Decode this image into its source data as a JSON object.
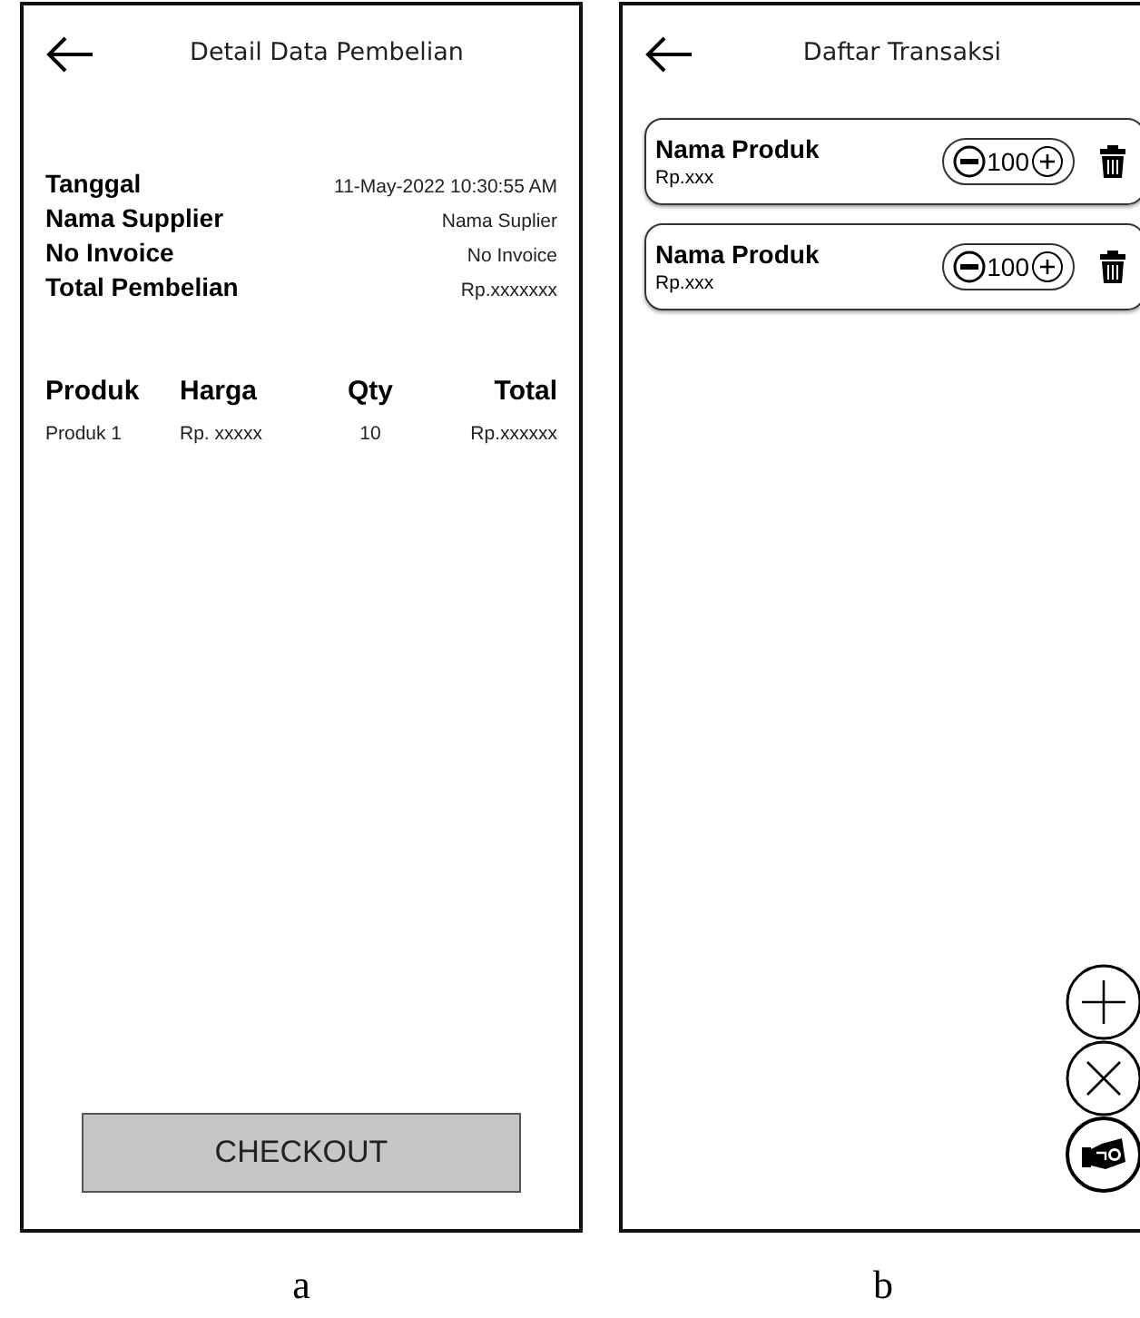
{
  "detail_screen": {
    "title": "Detail Data Pembelian",
    "fields": [
      {
        "label": "Tanggal",
        "value": "11-May-2022 10:30:55 AM"
      },
      {
        "label": "Nama Supplier",
        "value": "Nama Suplier"
      },
      {
        "label": "No Invoice",
        "value": "No Invoice"
      },
      {
        "label": "Total Pembelian",
        "value": "Rp.xxxxxxx"
      }
    ],
    "table": {
      "columns": [
        "Produk",
        "Harga",
        "Qty",
        "Total"
      ],
      "rows": [
        [
          "Produk 1",
          "Rp. xxxxx",
          "10",
          "Rp.xxxxxx"
        ]
      ]
    },
    "button": "CHECKOUT",
    "caption": "a"
  },
  "transaction_screen": {
    "title": "Daftar Transaksi",
    "items": [
      {
        "name": "Nama Produk",
        "price": "Rp.xxx",
        "quantity": "100"
      },
      {
        "name": "Nama Produk",
        "price": "Rp.xxx",
        "quantity": "100"
      }
    ],
    "caption": "b"
  }
}
